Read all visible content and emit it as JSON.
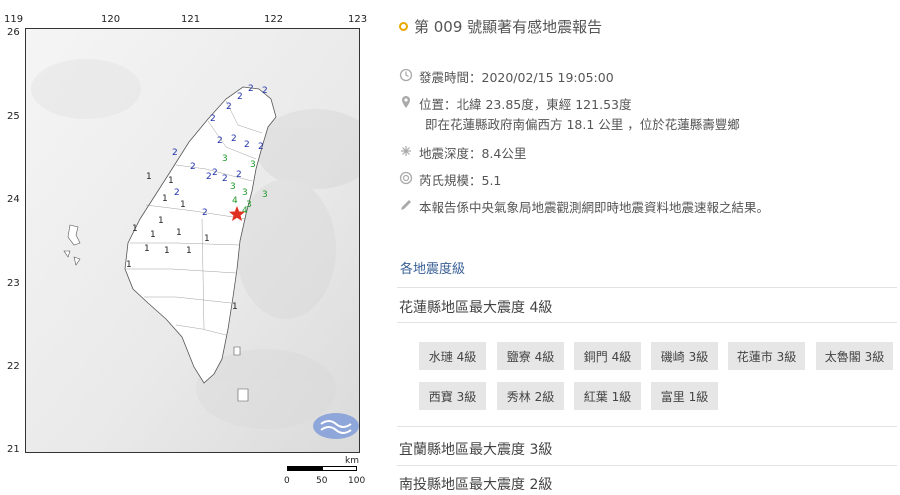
{
  "map": {
    "lon_ticks": [
      "119",
      "120",
      "121",
      "122",
      "123"
    ],
    "lat_ticks": [
      "26",
      "25",
      "24",
      "23",
      "22",
      "21"
    ],
    "scale": {
      "unit": "km",
      "labels": [
        "0",
        "50",
        "100"
      ]
    },
    "epicenter_color": "#e0301e",
    "stations": [
      {
        "v": "2",
        "c": "#2233aa"
      },
      {
        "v": "2",
        "c": "#2233aa"
      },
      {
        "v": "2",
        "c": "#2233aa"
      },
      {
        "v": "2",
        "c": "#2233aa"
      },
      {
        "v": "2",
        "c": "#2233aa"
      },
      {
        "v": "2",
        "c": "#2233aa"
      },
      {
        "v": "2",
        "c": "#2233aa"
      },
      {
        "v": "2",
        "c": "#2233aa"
      },
      {
        "v": "2",
        "c": "#2233aa"
      },
      {
        "v": "2",
        "c": "#2233aa"
      },
      {
        "v": "2",
        "c": "#2233aa"
      },
      {
        "v": "2",
        "c": "#2233aa"
      },
      {
        "v": "2",
        "c": "#2233aa"
      },
      {
        "v": "2",
        "c": "#2233aa"
      },
      {
        "v": "2",
        "c": "#2233aa"
      },
      {
        "v": "2",
        "c": "#2233aa"
      },
      {
        "v": "2",
        "c": "#2233aa"
      },
      {
        "v": "3",
        "c": "#1f9a2a"
      },
      {
        "v": "3",
        "c": "#1f9a2a"
      },
      {
        "v": "3",
        "c": "#1f9a2a"
      },
      {
        "v": "3",
        "c": "#1f9a2a"
      },
      {
        "v": "3",
        "c": "#1f9a2a"
      },
      {
        "v": "3",
        "c": "#1f9a2a"
      },
      {
        "v": "4",
        "c": "#1f9a2a"
      },
      {
        "v": "4",
        "c": "#1f9a2a"
      },
      {
        "v": "1",
        "c": "#222222"
      },
      {
        "v": "1",
        "c": "#222222"
      },
      {
        "v": "1",
        "c": "#222222"
      },
      {
        "v": "1",
        "c": "#222222"
      },
      {
        "v": "1",
        "c": "#222222"
      },
      {
        "v": "1",
        "c": "#222222"
      },
      {
        "v": "1",
        "c": "#222222"
      },
      {
        "v": "1",
        "c": "#222222"
      },
      {
        "v": "1",
        "c": "#222222"
      },
      {
        "v": "1",
        "c": "#222222"
      },
      {
        "v": "1",
        "c": "#222222"
      },
      {
        "v": "1",
        "c": "#222222"
      },
      {
        "v": "1",
        "c": "#222222"
      },
      {
        "v": "1",
        "c": "#222222"
      }
    ]
  },
  "report": {
    "title": "第 009 號顯著有感地震報告",
    "time": "發震時間：2020/02/15 19:05:00",
    "location_line1": "位置：北緯 23.85度，東經 121.53度",
    "location_line2": "即在花蓮縣政府南偏西方 18.1 公里 ，位於花蓮縣壽豐鄉",
    "depth": "地震深度：8.4公里",
    "magnitude": "芮氏規模：5.1",
    "note": "本報告係中央氣象局地震觀測網即時地震資料地震速報之結果。",
    "levels_link": "各地震度級",
    "regions": [
      {
        "heading": "花蓮縣地區最大震度 4級",
        "stations": [
          "水璉 4級",
          "鹽寮 4級",
          "銅門 4級",
          "磯崎 3級",
          "花蓮市 3級",
          "太魯閣 3級",
          "西寶 3級",
          "秀林 2級",
          "紅葉 1級",
          "富里 1級"
        ]
      },
      {
        "heading": "宜蘭縣地區最大震度 3級"
      },
      {
        "heading": "南投縣地區最大震度 2級"
      }
    ],
    "accent": "#e8a800",
    "link_color": "#3a5f95"
  }
}
